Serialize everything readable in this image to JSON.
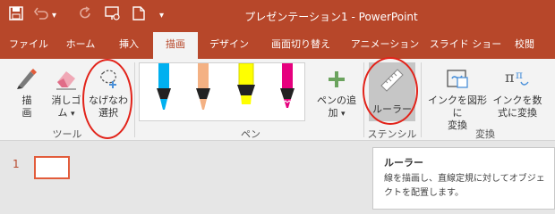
{
  "titlebar": {
    "doc_title": "プレゼンテーション1 - PowerPoint",
    "qat": [
      {
        "icon": "save-icon"
      },
      {
        "icon": "undo-icon"
      },
      {
        "icon": "redo-icon"
      },
      {
        "icon": "present-icon"
      },
      {
        "icon": "new-doc-icon"
      },
      {
        "icon": "customize-qat-icon"
      }
    ]
  },
  "tabs": [
    {
      "label": "ファイル",
      "active": false
    },
    {
      "label": "ホーム",
      "active": false
    },
    {
      "label": "挿入",
      "active": false
    },
    {
      "label": "描画",
      "active": true
    },
    {
      "label": "デザイン",
      "active": false
    },
    {
      "label": "画面切り替え",
      "active": false
    },
    {
      "label": "アニメーション",
      "active": false
    },
    {
      "label": "スライド ショー",
      "active": false
    },
    {
      "label": "校閲",
      "active": false
    }
  ],
  "ribbon": {
    "tools": {
      "draw": {
        "line1": "描",
        "line2": "画"
      },
      "eraser": {
        "line1": "消しゴ",
        "line2": "ム"
      },
      "lasso": {
        "line1": "なげなわ",
        "line2": "選択"
      },
      "group_label": "ツール"
    },
    "pens": {
      "items": [
        {
          "name": "pen-blue",
          "color": "#00b0f0"
        },
        {
          "name": "pen-pink",
          "color": "#f4b183"
        },
        {
          "name": "pen-yellow",
          "color": "#ffff00"
        },
        {
          "name": "pen-magenta",
          "color": "#e6007e"
        }
      ],
      "add_pen": {
        "line1": "ペンの追",
        "line2": "加"
      },
      "group_label": "ペン"
    },
    "stencil": {
      "ruler": {
        "label": "ルーラー"
      },
      "group_label": "ステンシル"
    },
    "convert": {
      "to_shape": {
        "line1": "インクを図形に",
        "line2": "変換"
      },
      "to_math": {
        "line1": "インクを数",
        "line2": "式に変換"
      },
      "group_label": "変換"
    }
  },
  "slides": {
    "number": "1"
  },
  "tooltip": {
    "title": "ルーラー",
    "body": "線を描画し、直線定規に対してオブジェクトを配置します。"
  },
  "colors": {
    "accent": "#b7472a",
    "highlight_oval": "#e2231a"
  }
}
